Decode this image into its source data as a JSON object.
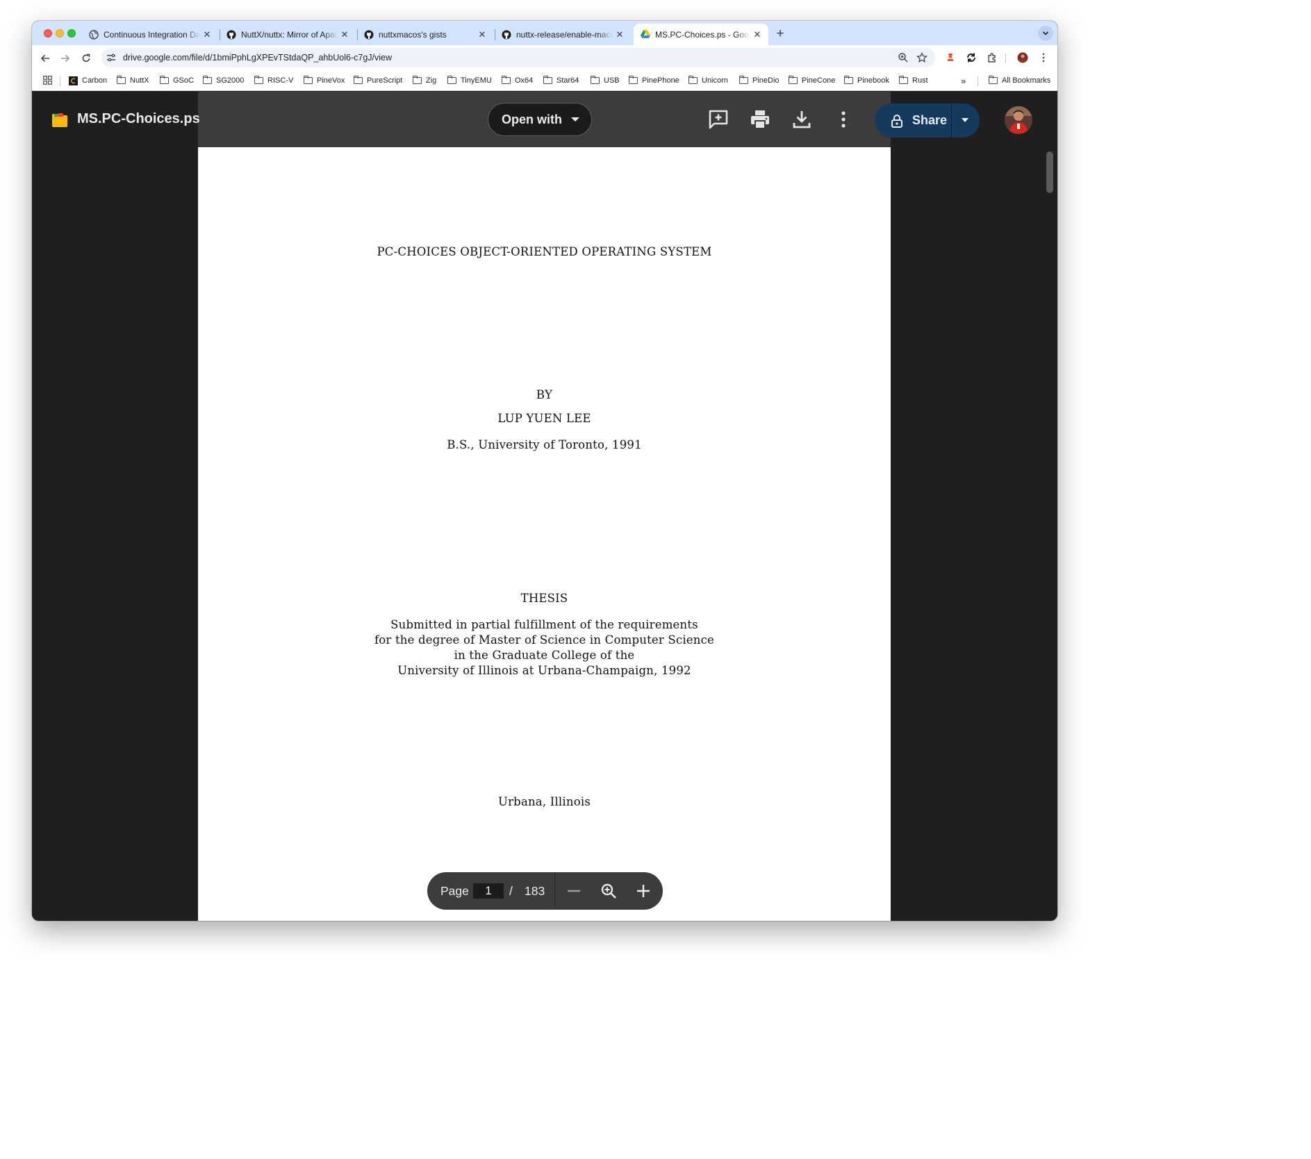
{
  "browser": {
    "tabs": [
      {
        "title": "Continuous Integration Dashboard",
        "favicon": "globe-icon",
        "active": false
      },
      {
        "title": "NuttX/nuttx: Mirror of Apache NuttX",
        "favicon": "github-icon",
        "active": false
      },
      {
        "title": "nuttxmacos's gists",
        "favicon": "github-icon",
        "active": false
      },
      {
        "title": "nuttx-release/enable-macos-windows",
        "favicon": "github-icon",
        "active": false
      },
      {
        "title": "MS.PC-Choices.ps - Google Drive",
        "favicon": "google-drive-icon",
        "active": true
      }
    ],
    "new_tab": "+",
    "url": "drive.google.com/file/d/1bmiPphLgXPEvTStdaQP_ahbUol6-c7gJ/view",
    "bookmarks": [
      "Carbon",
      "NuttX",
      "GSoC",
      "SG2000",
      "RISC-V",
      "PineVox",
      "PureScript",
      "Zig",
      "TinyEMU",
      "Ox64",
      "Star64",
      "USB",
      "PinePhone",
      "Unicorn",
      "PineDio",
      "PineCone",
      "Pinebook",
      "Rust"
    ],
    "bookmarks_overflow": "»",
    "all_bookmarks": "All Bookmarks"
  },
  "viewer": {
    "file_name": "MS.PC-Choices.ps",
    "open_with": "Open with",
    "share": "Share",
    "page_label": "Page",
    "current_page": "1",
    "page_separator": "/",
    "total_pages": "183"
  },
  "document": {
    "title": "PC-CHOICES OBJECT-ORIENTED OPERATING SYSTEM",
    "by": "BY",
    "author": "LUP YUEN LEE",
    "prior_degree": "B.S., University of Toronto, 1991",
    "thesis": "THESIS",
    "statement": [
      "Submitted in partial fulfillment of the requirements",
      "for the degree of Master of Science in Computer Science",
      "in the Graduate College of the",
      "University of Illinois at Urbana-Champaign, 1992"
    ],
    "place": "Urbana, Illinois"
  },
  "colors": {
    "tab_strip": "#d3e3fd",
    "viewer_bg": "#1f1f1f",
    "viewer_header": "#3c3c3c",
    "share_button": "#163a5e"
  }
}
